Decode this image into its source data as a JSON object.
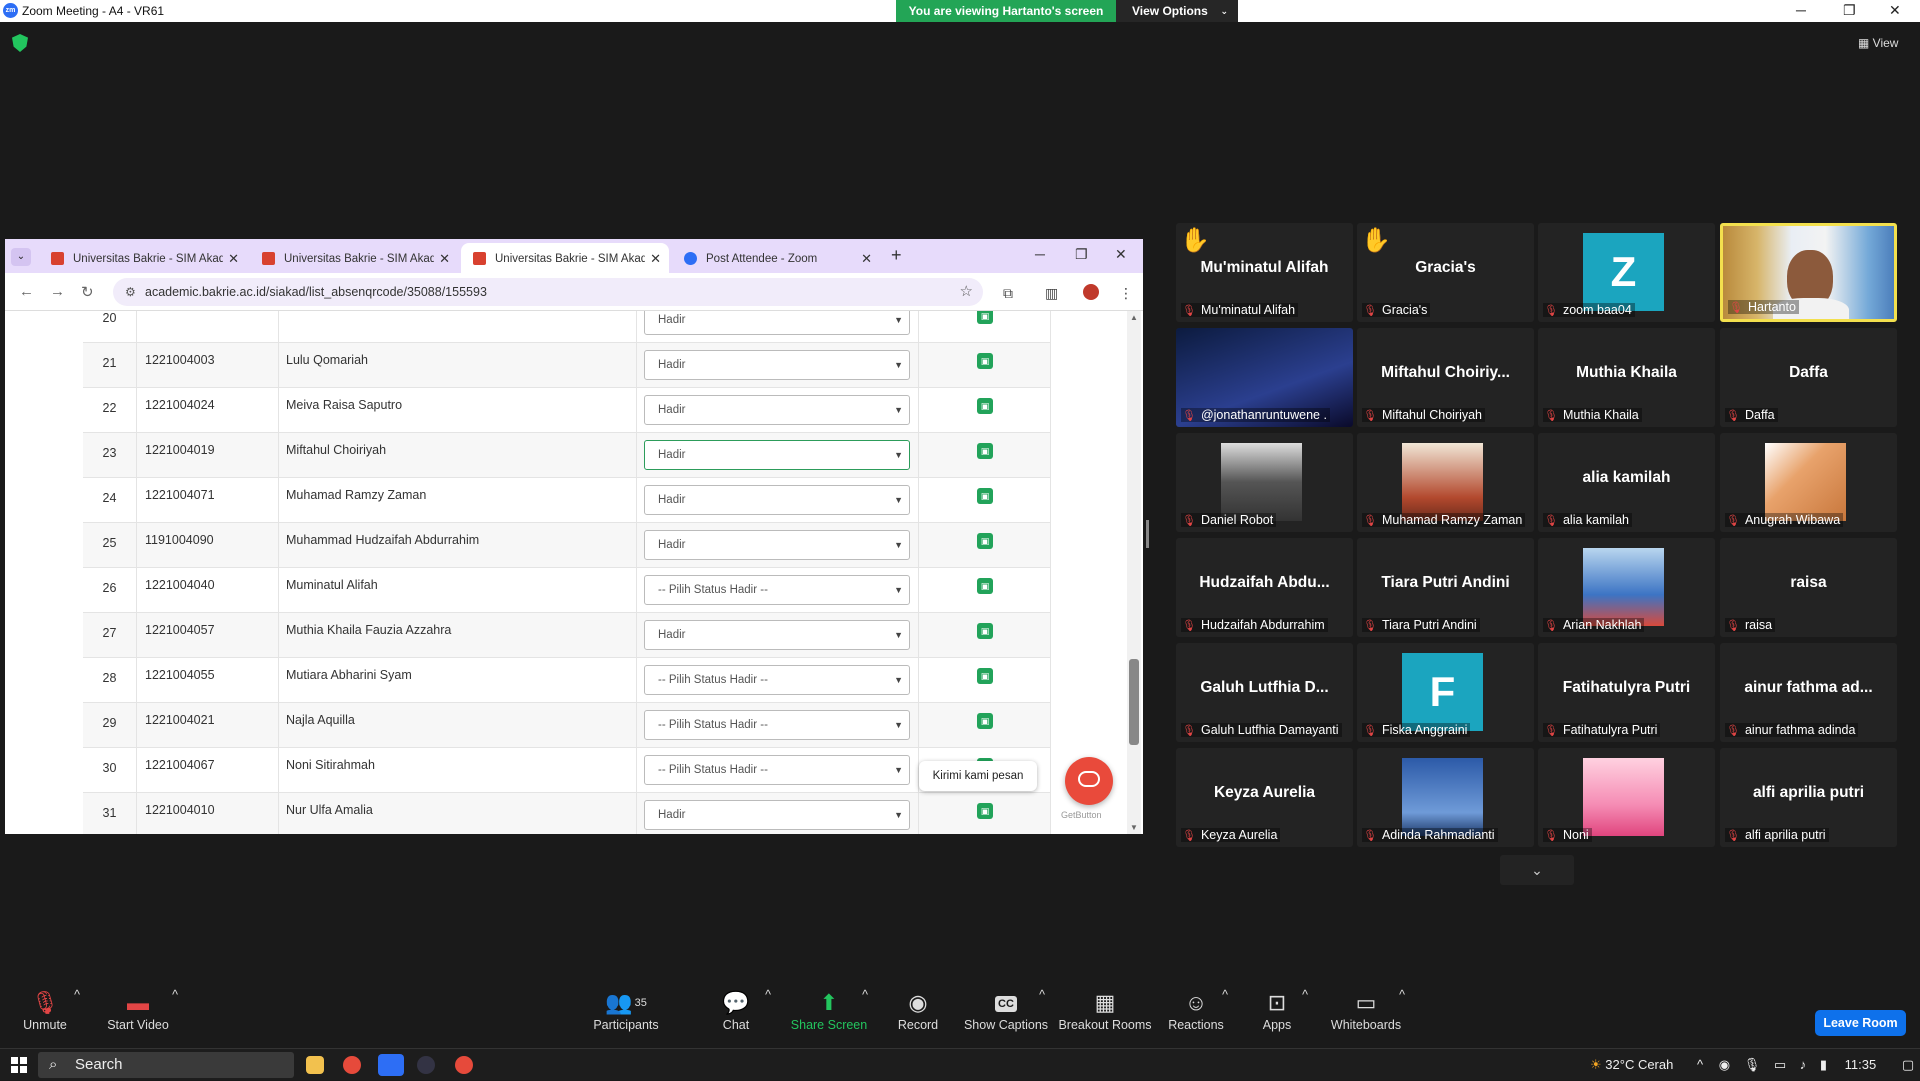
{
  "titlebar": {
    "app_title": "Zoom Meeting - A4 - VR61",
    "viewing_text": "You are viewing Hartanto's screen",
    "view_options": "View Options",
    "logo": "zm"
  },
  "view_button": "View",
  "browser": {
    "tabs": [
      {
        "title": "Universitas Bakrie - SIM Akaden"
      },
      {
        "title": "Universitas Bakrie - SIM Akaden"
      },
      {
        "title": "Universitas Bakrie - SIM Akaden"
      },
      {
        "title": "Post Attendee - Zoom"
      }
    ],
    "url": "academic.bakrie.ac.id/siakad/list_absenqrcode/35088/155593"
  },
  "attendance": {
    "rows": [
      {
        "no": "20",
        "nim": "",
        "name": "",
        "status": "Hadir"
      },
      {
        "no": "21",
        "nim": "1221004003",
        "name": "Lulu Qomariah",
        "status": "Hadir"
      },
      {
        "no": "22",
        "nim": "1221004024",
        "name": "Meiva Raisa Saputro",
        "status": "Hadir"
      },
      {
        "no": "23",
        "nim": "1221004019",
        "name": "Miftahul Choiriyah",
        "status": "Hadir"
      },
      {
        "no": "24",
        "nim": "1221004071",
        "name": "Muhamad Ramzy Zaman",
        "status": "Hadir"
      },
      {
        "no": "25",
        "nim": "1191004090",
        "name": "Muhammad Hudzaifah Abdurrahim",
        "status": "Hadir"
      },
      {
        "no": "26",
        "nim": "1221004040",
        "name": "Muminatul Alifah",
        "status": "-- Pilih Status Hadir --"
      },
      {
        "no": "27",
        "nim": "1221004057",
        "name": "Muthia Khaila Fauzia Azzahra",
        "status": "Hadir"
      },
      {
        "no": "28",
        "nim": "1221004055",
        "name": "Mutiara Abharini Syam",
        "status": "-- Pilih Status Hadir --"
      },
      {
        "no": "29",
        "nim": "1221004021",
        "name": "Najla Aquilla",
        "status": "-- Pilih Status Hadir --"
      },
      {
        "no": "30",
        "nim": "1221004067",
        "name": "Noni Sitirahmah",
        "status": "-- Pilih Status Hadir --"
      },
      {
        "no": "31",
        "nim": "1221004010",
        "name": "Nur Ulfa Amalia",
        "status": "Hadir"
      }
    ],
    "chat_bubble": "Kirimi kami pesan",
    "getbutton": "GetButton"
  },
  "participants": [
    {
      "big": "Mu'minatul Alifah",
      "label": "Mu'minatul Alifah",
      "hand": true
    },
    {
      "big": "Gracia's",
      "label": "Gracia's",
      "hand": true
    },
    {
      "big": "Z",
      "label": "zoom baa04",
      "avatar": "letter"
    },
    {
      "big": "",
      "label": "Hartanto",
      "avatar": "video",
      "speaking": true
    },
    {
      "big": "",
      "label": "@jonathanruntuwene .",
      "avatar": "photo"
    },
    {
      "big": "Miftahul  Choiriy...",
      "label": "Miftahul Choiriyah"
    },
    {
      "big": "Muthia Khaila",
      "label": "Muthia Khaila"
    },
    {
      "big": "Daffa",
      "label": "Daffa"
    },
    {
      "big": "",
      "label": "Daniel Robot",
      "avatar": "photo"
    },
    {
      "big": "",
      "label": "Muhamad Ramzy Zaman",
      "avatar": "photo"
    },
    {
      "big": "alia kamilah",
      "label": "alia kamilah"
    },
    {
      "big": "",
      "label": "Anugrah Wibawa",
      "avatar": "photo"
    },
    {
      "big": "Hudzaifah  Abdu...",
      "label": "Hudzaifah Abdurrahim"
    },
    {
      "big": "Tiara Putri Andini",
      "label": "Tiara Putri Andini"
    },
    {
      "big": "",
      "label": "Arian Nakhlah",
      "avatar": "photo"
    },
    {
      "big": "raisa",
      "label": "raisa"
    },
    {
      "big": "Galuh  Lutfhia  D...",
      "label": "Galuh Lutfhia Damayanti"
    },
    {
      "big": "F",
      "label": "Fiska Anggraini",
      "avatar": "letter"
    },
    {
      "big": "Fatihatulyra Putri",
      "label": "Fatihatulyra Putri"
    },
    {
      "big": "ainur  fathma  ad...",
      "label": "ainur fathma adinda"
    },
    {
      "big": "Keyza Aurelia",
      "label": "Keyza Aurelia"
    },
    {
      "big": "",
      "label": "Adinda Rahmadianti",
      "avatar": "photo"
    },
    {
      "big": "",
      "label": "Noni",
      "avatar": "photo"
    },
    {
      "big": "alfi aprilia putri",
      "label": "alfi aprilia putri"
    }
  ],
  "toolbar": {
    "unmute": "Unmute",
    "start_video": "Start Video",
    "participants": "Participants",
    "participants_count": "35",
    "chat": "Chat",
    "share": "Share Screen",
    "record": "Record",
    "captions": "Show Captions",
    "captions_badge": "CC",
    "breakout": "Breakout Rooms",
    "reactions": "Reactions",
    "apps": "Apps",
    "whiteboards": "Whiteboards",
    "leave": "Leave Room"
  },
  "taskbar": {
    "search": "Search",
    "weather": "32°C  Cerah",
    "time": "11:35"
  },
  "colors": {
    "zoom_blue": "#0e71eb",
    "share_green": "#23a556",
    "save_green": "#22a35a",
    "chat_red": "#e94a3b"
  }
}
